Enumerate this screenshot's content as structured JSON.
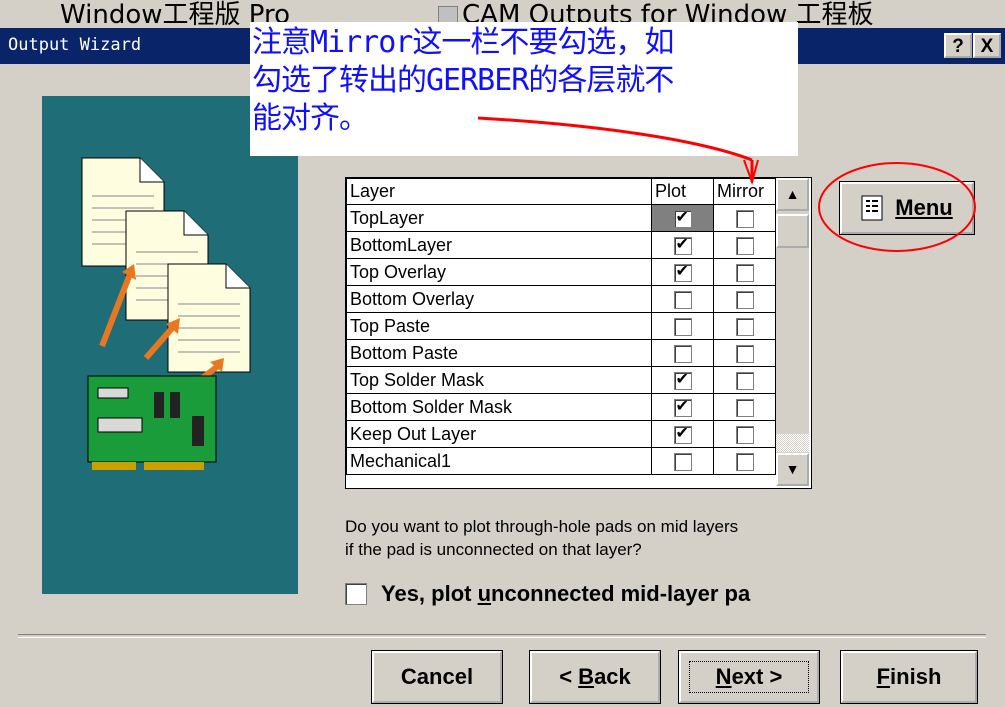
{
  "background_taskbar": {
    "left_text": "Window工程版 Pro",
    "right_text": "CAM Outputs for Window 工程板"
  },
  "window": {
    "title": "Output Wizard",
    "help_button": "?",
    "close_button": "X"
  },
  "annotation": {
    "text": "注意Mirror这一栏不要勾选，如\n勾选了转出的GERBER的各层就不\n能对齐。",
    "color": "#1010ff",
    "highlight_color": "#ff0000"
  },
  "layer_grid": {
    "headers": {
      "layer": "Layer",
      "plot": "Plot",
      "mirror": "Mirror"
    },
    "rows": [
      {
        "layer": "TopLayer",
        "plot": true,
        "mirror": false
      },
      {
        "layer": "BottomLayer",
        "plot": true,
        "mirror": false
      },
      {
        "layer": "Top Overlay",
        "plot": true,
        "mirror": false
      },
      {
        "layer": "Bottom Overlay",
        "plot": false,
        "mirror": false
      },
      {
        "layer": "Top Paste",
        "plot": false,
        "mirror": false
      },
      {
        "layer": "Bottom Paste",
        "plot": false,
        "mirror": false
      },
      {
        "layer": "Top Solder Mask",
        "plot": true,
        "mirror": false
      },
      {
        "layer": "Bottom Solder Mask",
        "plot": true,
        "mirror": false
      },
      {
        "layer": "Keep Out Layer",
        "plot": true,
        "mirror": false
      },
      {
        "layer": "Mechanical1",
        "plot": false,
        "mirror": false
      }
    ]
  },
  "menu_button": {
    "label": "Menu"
  },
  "question": {
    "line1": "Do you want to plot through-hole pads on mid layers",
    "line2": "if the pad is unconnected on that layer?"
  },
  "option": {
    "label_before": "Yes, plot ",
    "label_underlined": "u",
    "label_after": "nconnected mid-layer pa",
    "checked": false
  },
  "buttons": {
    "cancel": "Cancel",
    "back_prefix": "< ",
    "back_ul": "B",
    "back_rest": "ack",
    "next_ul": "N",
    "next_rest": "ext >",
    "finish_ul": "F",
    "finish_rest": "inish"
  }
}
